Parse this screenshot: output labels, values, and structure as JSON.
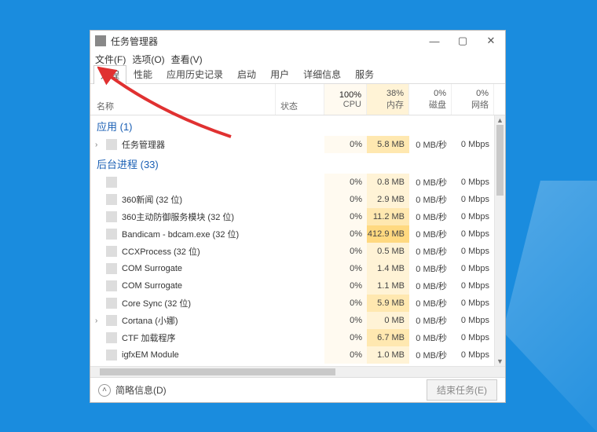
{
  "window": {
    "title": "任务管理器"
  },
  "menu": {
    "file": "文件(F)",
    "options": "选项(O)",
    "view": "查看(V)"
  },
  "tabs": [
    {
      "label": "进程",
      "active": true
    },
    {
      "label": "性能"
    },
    {
      "label": "应用历史记录"
    },
    {
      "label": "启动"
    },
    {
      "label": "用户"
    },
    {
      "label": "详细信息"
    },
    {
      "label": "服务"
    }
  ],
  "columns": {
    "name": "名称",
    "status": "状态",
    "cpu": {
      "pct": "100%",
      "label": "CPU"
    },
    "memory": {
      "pct": "38%",
      "label": "内存"
    },
    "disk": {
      "pct": "0%",
      "label": "磁盘"
    },
    "network": {
      "pct": "0%",
      "label": "网络"
    }
  },
  "groups": {
    "apps": {
      "title": "应用 (1)"
    },
    "background": {
      "title": "后台进程 (33)"
    }
  },
  "processes": {
    "apps": [
      {
        "name": "任务管理器",
        "expandable": true,
        "cpu": "0%",
        "mem": "5.8 MB",
        "disk": "0 MB/秒",
        "net": "0 Mbps",
        "mem_heat": 2
      }
    ],
    "background": [
      {
        "name": "",
        "cpu": "0%",
        "mem": "0.8 MB",
        "disk": "0 MB/秒",
        "net": "0 Mbps",
        "mem_heat": 1
      },
      {
        "name": "360新闻 (32 位)",
        "cpu": "0%",
        "mem": "2.9 MB",
        "disk": "0 MB/秒",
        "net": "0 Mbps",
        "mem_heat": 1
      },
      {
        "name": "360主动防御服务模块 (32 位)",
        "cpu": "0%",
        "mem": "11.2 MB",
        "disk": "0 MB/秒",
        "net": "0 Mbps",
        "mem_heat": 2
      },
      {
        "name": "Bandicam - bdcam.exe (32 位)",
        "cpu": "0%",
        "mem": "412.9 MB",
        "disk": "0 MB/秒",
        "net": "0 Mbps",
        "mem_heat": 3
      },
      {
        "name": "CCXProcess (32 位)",
        "cpu": "0%",
        "mem": "0.5 MB",
        "disk": "0 MB/秒",
        "net": "0 Mbps",
        "mem_heat": 1
      },
      {
        "name": "COM Surrogate",
        "cpu": "0%",
        "mem": "1.4 MB",
        "disk": "0 MB/秒",
        "net": "0 Mbps",
        "mem_heat": 1
      },
      {
        "name": "COM Surrogate",
        "cpu": "0%",
        "mem": "1.1 MB",
        "disk": "0 MB/秒",
        "net": "0 Mbps",
        "mem_heat": 1
      },
      {
        "name": "Core Sync (32 位)",
        "cpu": "0%",
        "mem": "5.9 MB",
        "disk": "0 MB/秒",
        "net": "0 Mbps",
        "mem_heat": 2
      },
      {
        "name": "Cortana (小娜)",
        "expandable": true,
        "cpu": "0%",
        "mem": "0 MB",
        "disk": "0 MB/秒",
        "net": "0 Mbps",
        "mem_heat": 1
      },
      {
        "name": "CTF 加载程序",
        "cpu": "0%",
        "mem": "6.7 MB",
        "disk": "0 MB/秒",
        "net": "0 Mbps",
        "mem_heat": 2
      },
      {
        "name": "igfxEM Module",
        "cpu": "0%",
        "mem": "1.0 MB",
        "disk": "0 MB/秒",
        "net": "0 Mbps",
        "mem_heat": 1
      }
    ]
  },
  "statusbar": {
    "less_details": "简略信息(D)",
    "end_task": "结束任务(E)"
  }
}
